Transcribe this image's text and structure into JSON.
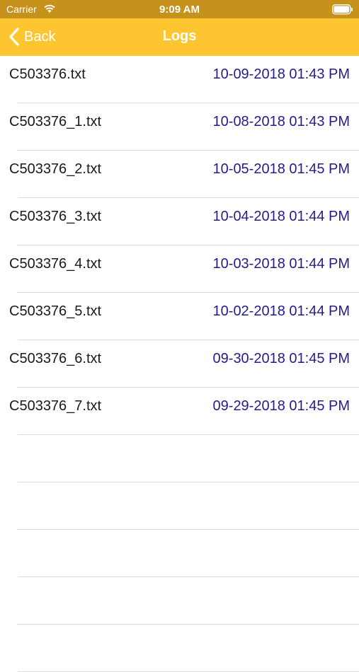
{
  "status_bar": {
    "carrier": "Carrier",
    "time": "9:09 AM",
    "wifi_icon": "wifi-icon",
    "battery_icon": "battery-icon"
  },
  "nav": {
    "back_label": "Back",
    "back_icon": "chevron-left-icon",
    "title": "Logs"
  },
  "colors": {
    "status_bar_bg": "#c6921c",
    "nav_bar_bg": "#fdc631",
    "date_text": "#241c8c",
    "separator": "#dcdcdc"
  },
  "logs": [
    {
      "name": "C503376.txt",
      "date": "10-09-2018 01:43 PM"
    },
    {
      "name": "C503376_1.txt",
      "date": "10-08-2018 01:43 PM"
    },
    {
      "name": "C503376_2.txt",
      "date": "10-05-2018 01:45 PM"
    },
    {
      "name": "C503376_3.txt",
      "date": "10-04-2018 01:44 PM"
    },
    {
      "name": "C503376_4.txt",
      "date": "10-03-2018 01:44 PM"
    },
    {
      "name": "C503376_5.txt",
      "date": "10-02-2018 01:44 PM"
    },
    {
      "name": "C503376_6.txt",
      "date": "09-30-2018 01:45 PM"
    },
    {
      "name": "C503376_7.txt",
      "date": "09-29-2018 01:45 PM"
    },
    {
      "name": "",
      "date": ""
    },
    {
      "name": "",
      "date": ""
    },
    {
      "name": "",
      "date": ""
    },
    {
      "name": "",
      "date": ""
    },
    {
      "name": "",
      "date": ""
    }
  ]
}
